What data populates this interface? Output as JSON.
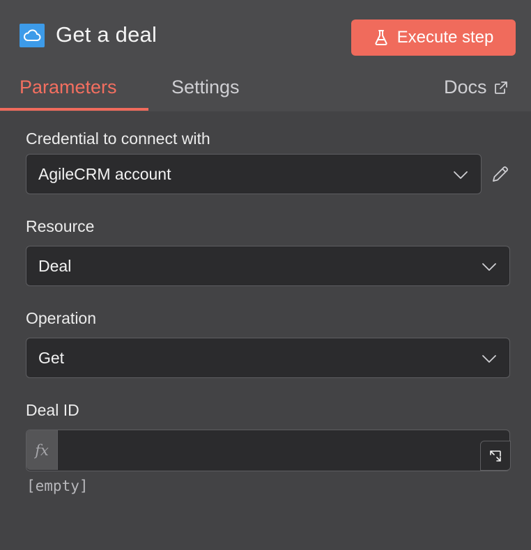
{
  "header": {
    "title": "Get a deal",
    "node_icon": "cloud-icon",
    "execute_label": "Execute step",
    "execute_icon": "flask-icon",
    "accent_color": "#f06b5c"
  },
  "tabs": {
    "parameters": "Parameters",
    "settings": "Settings",
    "docs": "Docs",
    "active": "Parameters"
  },
  "fields": {
    "credential": {
      "label": "Credential to connect with",
      "value": "AgileCRM account"
    },
    "resource": {
      "label": "Resource",
      "value": "Deal"
    },
    "operation": {
      "label": "Operation",
      "value": "Get"
    },
    "deal_id": {
      "label": "Deal ID",
      "value": "",
      "expression_toggle": "fx",
      "hint": "[empty]"
    }
  }
}
